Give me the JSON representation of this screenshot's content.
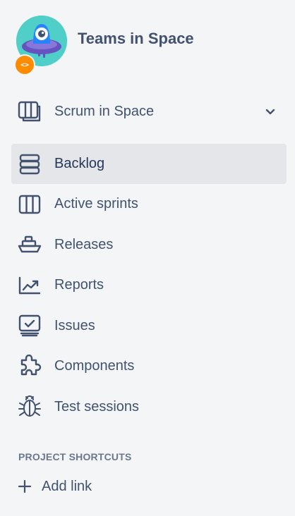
{
  "project": {
    "name": "Teams in Space",
    "avatar_icon": "rocket-alien-icon",
    "badge_icon": "code-icon",
    "badge_text": "<>",
    "colors": {
      "avatar_bg": "#4fcfc8",
      "badge_bg": "#ff8b00"
    }
  },
  "board_switcher": {
    "label": "Scrum in Space",
    "icon": "board-icon",
    "chevron": "chevron-down-icon"
  },
  "nav": {
    "items": [
      {
        "label": "Backlog",
        "icon": "backlog-icon",
        "active": true
      },
      {
        "label": "Active sprints",
        "icon": "board-icon",
        "active": false
      },
      {
        "label": "Releases",
        "icon": "ship-icon",
        "active": false
      },
      {
        "label": "Reports",
        "icon": "chart-icon",
        "active": false
      },
      {
        "label": "Issues",
        "icon": "issues-icon",
        "active": false
      },
      {
        "label": "Components",
        "icon": "puzzle-icon",
        "active": false
      },
      {
        "label": "Test sessions",
        "icon": "bug-icon",
        "active": false
      }
    ]
  },
  "shortcuts": {
    "heading": "PROJECT SHORTCUTS",
    "add_link_label": "Add link",
    "add_icon": "plus-icon"
  },
  "colors": {
    "sidebar_bg": "#f4f5f7",
    "text": "#42526e",
    "active_bg": "#e4e6ea",
    "heading": "#6b778c"
  }
}
